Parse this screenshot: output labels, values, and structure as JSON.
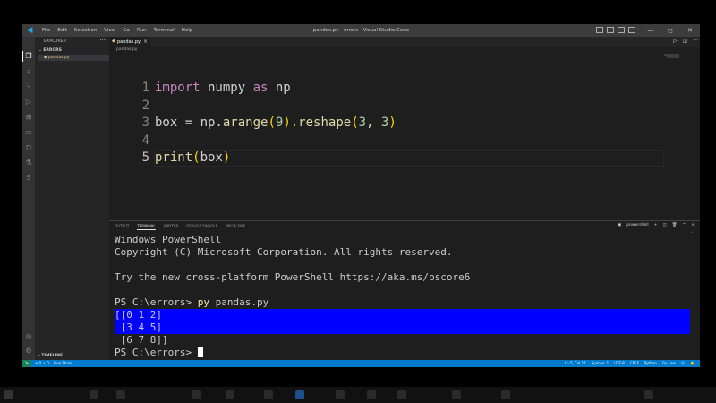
{
  "window": {
    "title": "pandas.py - errors - Visual Studio Code"
  },
  "menu": [
    "File",
    "Edit",
    "Selection",
    "View",
    "Go",
    "Run",
    "Terminal",
    "Help"
  ],
  "window_controls": [
    "—",
    "◻",
    "✕"
  ],
  "activity_icons": [
    "files-icon",
    "search-icon",
    "source-control-icon",
    "run-debug-icon",
    "extensions-icon",
    "remote-explorer-icon",
    "bookmark-icon",
    "testing-icon",
    "python-icon"
  ],
  "sidebar": {
    "title": "EXPLORER",
    "folder": "ERRORS",
    "files": [
      {
        "name": "pandas.py"
      }
    ],
    "timeline": "TIMELINE"
  },
  "editor": {
    "tab": "pandas.py",
    "breadcrumb": "pandas.py",
    "lines": [
      {
        "n": "1"
      },
      {
        "n": "2"
      },
      {
        "n": "3"
      },
      {
        "n": "4"
      },
      {
        "n": "5"
      }
    ],
    "code": {
      "l1_import": "import",
      "l1_mod": " numpy ",
      "l1_as": "as",
      "l1_alias": " np",
      "l3_a": "box = np.",
      "l3_fn": "arange",
      "l3_p1": "(",
      "l3_n1": "9",
      "l3_p2": ").",
      "l3_fn2": "reshape",
      "l3_p3": "(",
      "l3_n2": "3",
      "l3_c": ", ",
      "l3_n3": "3",
      "l3_p4": ")",
      "l5_fn": "print",
      "l5_p1": "(",
      "l5_arg": "box",
      "l5_p2": ")"
    }
  },
  "panel": {
    "tabs": [
      "OUTPUT",
      "TERMINAL",
      "JUPYTER",
      "DEBUG CONSOLE",
      "PROBLEMS"
    ],
    "active_tab": "TERMINAL",
    "shell": "powershell",
    "terminal": {
      "l1": "Windows PowerShell",
      "l2": "Copyright (C) Microsoft Corporation. All rights reserved.",
      "l3": "Try the new cross-platform PowerShell https://aka.ms/pscore6",
      "prompt1": "PS C:\\errors> ",
      "cmd_py": "py",
      "cmd_file": " pandas.py",
      "out1": "[[0 1 2]",
      "out2": " [3 4 5]",
      "out3": " [6 7 8]]",
      "prompt2": "PS C:\\errors> "
    }
  },
  "status": {
    "left": [
      "⊗ 0 ⚠ 0",
      "Live Share"
    ],
    "right": [
      "Ln 5, Col 11",
      "Spaces: 1",
      "UTF-8",
      "CRLF",
      "Python",
      "Go Live"
    ]
  },
  "colors": {
    "accent": "#007acc",
    "selection": "#0000ff",
    "keyword": "#c586c0",
    "function": "#dcdcaa",
    "number": "#b5cea8"
  }
}
